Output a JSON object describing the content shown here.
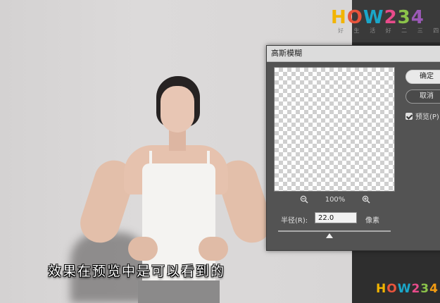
{
  "logo": {
    "top_text": "HOW234",
    "top_sub": "好 生 活 好 二 三 四",
    "bottom_text": "HOW234"
  },
  "subtitle": "效果在预览中是可以看到的",
  "dialog": {
    "title": "高斯模糊",
    "ok_label": "确定",
    "cancel_label": "取消",
    "preview_label": "预览(P)",
    "preview_checked": true,
    "zoom_out_icon": "zoom-out-icon",
    "zoom_in_icon": "zoom-in-icon",
    "zoom_level": "100%",
    "radius_label": "半径(R):",
    "radius_value": "22.0",
    "radius_unit": "像素"
  }
}
